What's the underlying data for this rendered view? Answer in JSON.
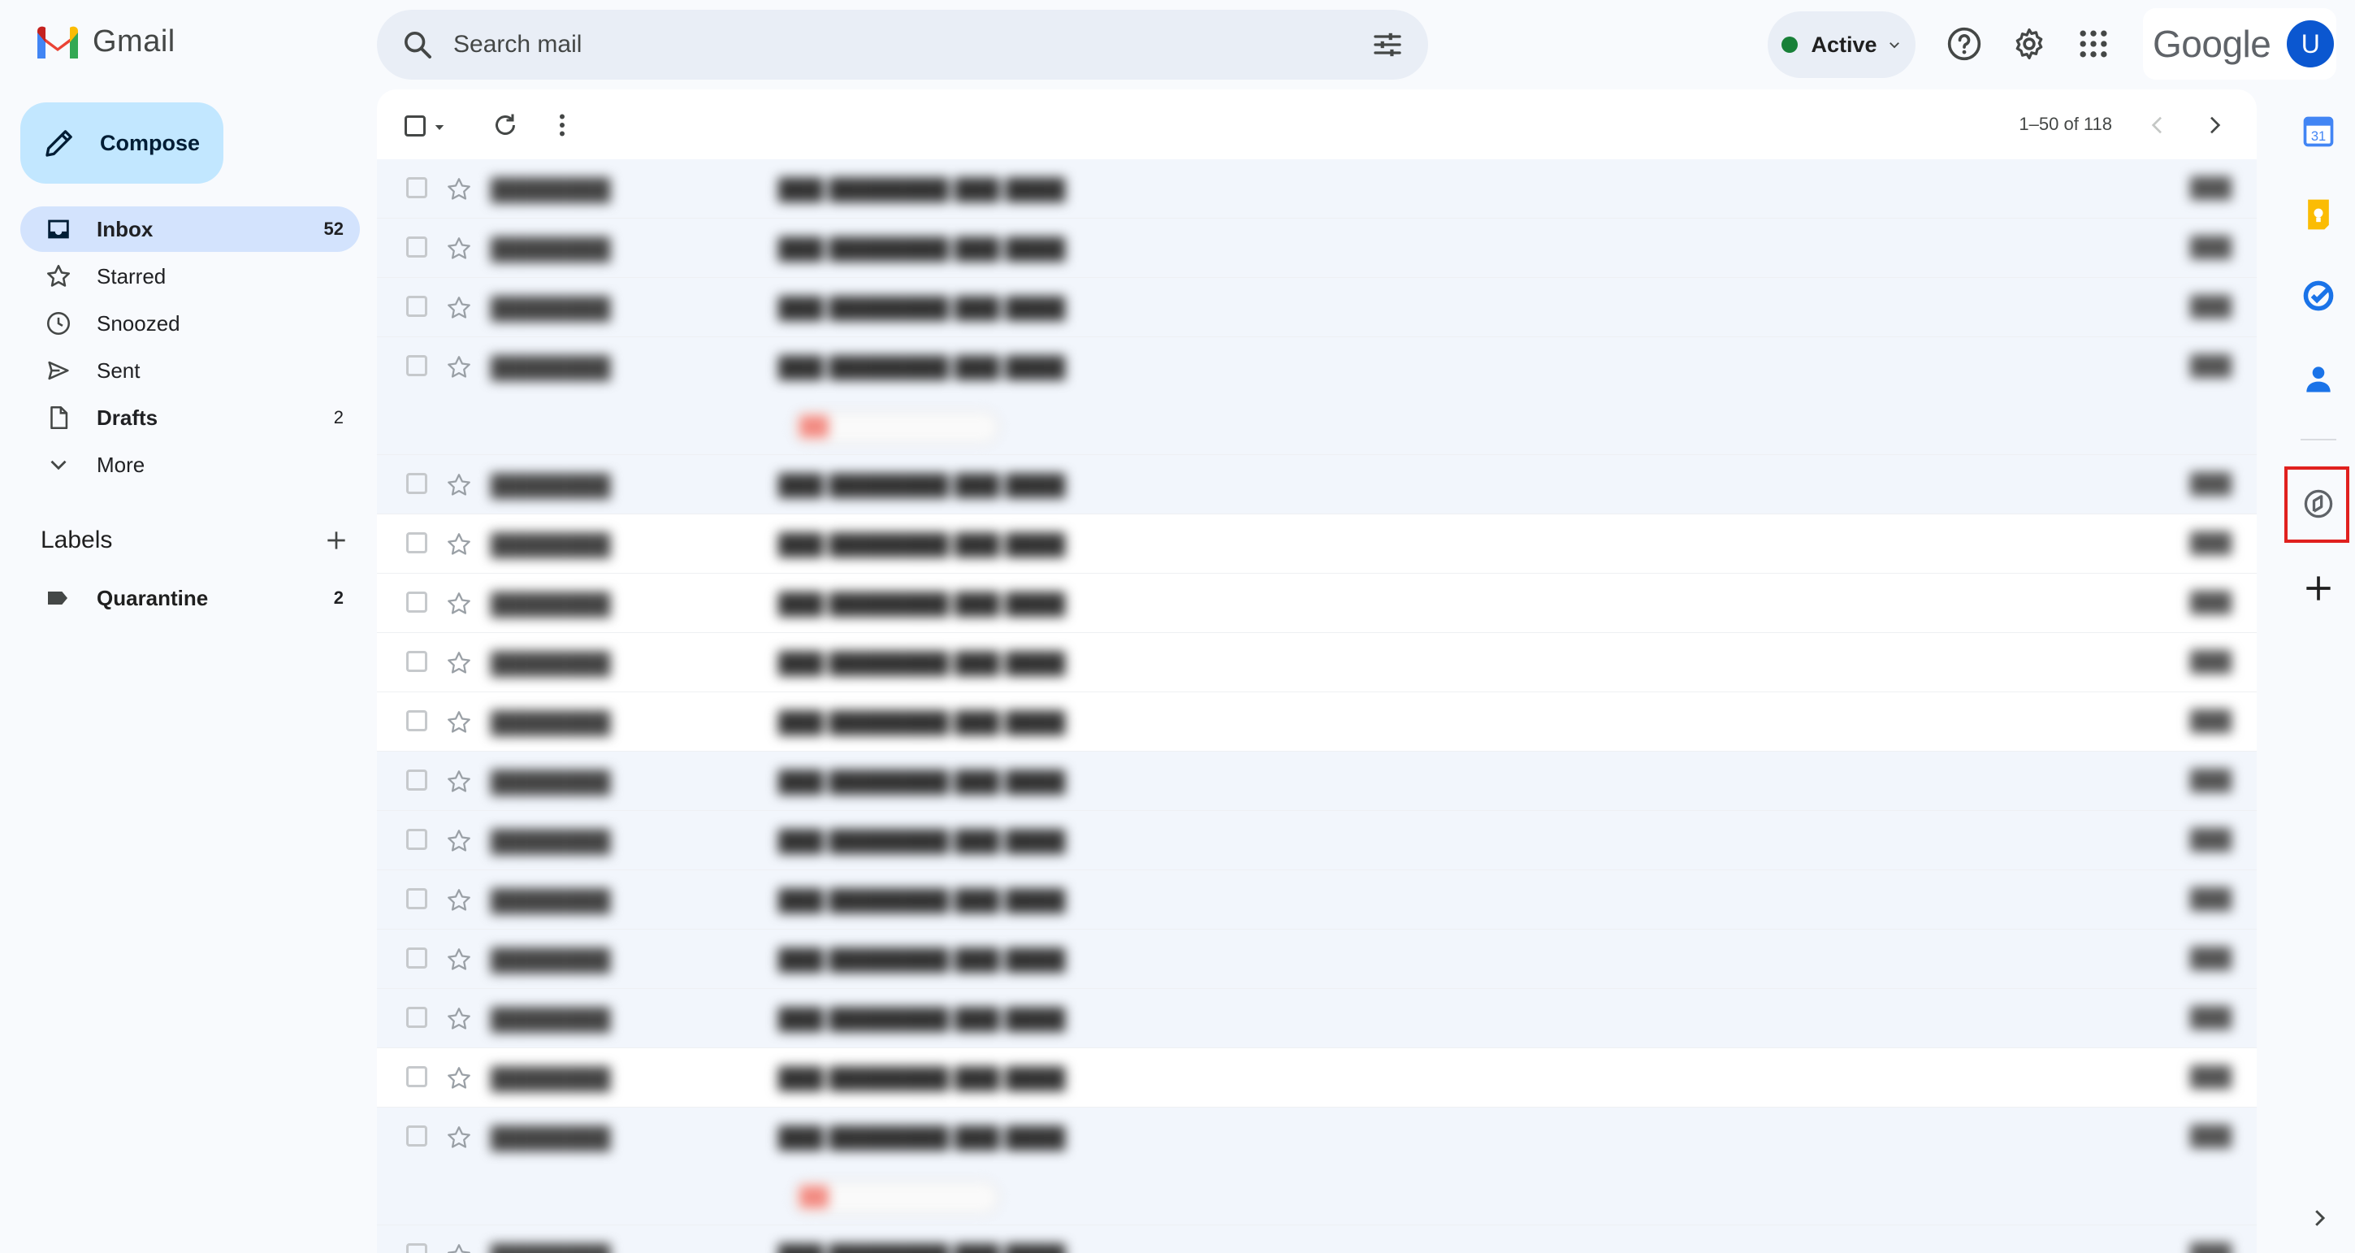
{
  "app": {
    "name": "Gmail"
  },
  "search": {
    "placeholder": "Search mail"
  },
  "status": {
    "label": "Active",
    "color": "#188038"
  },
  "account": {
    "brand": "Google",
    "avatar_initial": "U"
  },
  "compose": {
    "label": "Compose"
  },
  "nav": [
    {
      "label": "Inbox",
      "count": "52",
      "icon": "inbox-icon",
      "active": true
    },
    {
      "label": "Starred",
      "count": "",
      "icon": "star-icon"
    },
    {
      "label": "Snoozed",
      "count": "",
      "icon": "clock-icon"
    },
    {
      "label": "Sent",
      "count": "",
      "icon": "send-icon"
    },
    {
      "label": "Drafts",
      "count": "2",
      "icon": "draft-icon",
      "bold": true
    },
    {
      "label": "More",
      "count": "",
      "icon": "chevron-down-icon"
    }
  ],
  "labels": {
    "heading": "Labels",
    "items": [
      {
        "label": "Quarantine",
        "count": "2",
        "icon": "label-icon"
      }
    ]
  },
  "pagination": {
    "text": "1–50 of 118"
  },
  "rows_text": {
    "sender": "████████",
    "subject": "███ ████████ ███ ████",
    "date": "███"
  },
  "right_rail": [
    {
      "icon": "calendar-icon",
      "day": "31"
    },
    {
      "icon": "keep-icon"
    },
    {
      "icon": "tasks-icon"
    },
    {
      "icon": "contacts-icon"
    },
    {
      "icon": "addon-icon",
      "highlighted": true
    },
    {
      "icon": "add-addon-icon"
    }
  ],
  "colors": {
    "accent": "#0b57d0",
    "compose_bg": "#c2e7ff",
    "active_nav": "#d3e3fd",
    "highlight_box": "#e0201e"
  }
}
